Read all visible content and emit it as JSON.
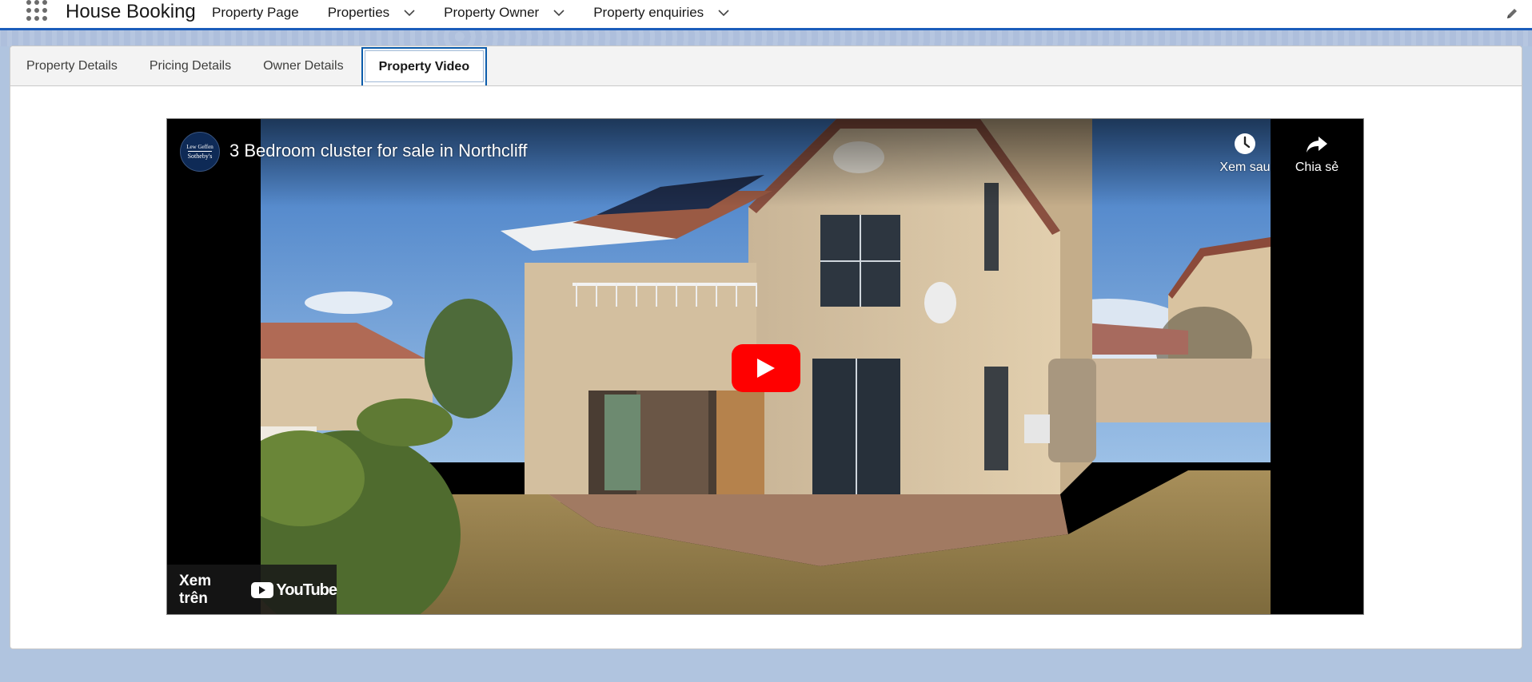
{
  "app": {
    "name": "House Booking"
  },
  "nav": {
    "items": [
      {
        "label": "Property Page",
        "has_menu": false
      },
      {
        "label": "Properties",
        "has_menu": true
      },
      {
        "label": "Property Owner",
        "has_menu": true
      },
      {
        "label": "Property enquiries",
        "has_menu": true
      }
    ]
  },
  "tabs": [
    {
      "label": "Property Details",
      "active": false
    },
    {
      "label": "Pricing Details",
      "active": false
    },
    {
      "label": "Owner Details",
      "active": false
    },
    {
      "label": "Property Video",
      "active": true
    }
  ],
  "video": {
    "title": "3 Bedroom cluster for sale in Northcliff",
    "channel_logo": {
      "line1": "Lew Geffen",
      "line2": "Sotheby's"
    },
    "watch_later_label": "Xem sau",
    "share_label": "Chia sẻ",
    "watch_on_label": "Xem trên",
    "youtube_wordmark": "YouTube"
  },
  "colors": {
    "header_border": "#1b5dbb",
    "active_tab_border": "#0b5cab",
    "page_background": "#b0c4df",
    "play_button": "#ff0000"
  },
  "icons": [
    "app-launcher-icon",
    "chevron-down-icon",
    "edit-pencil-icon",
    "clock-icon",
    "share-arrow-icon",
    "play-icon",
    "youtube-play-icon"
  ]
}
